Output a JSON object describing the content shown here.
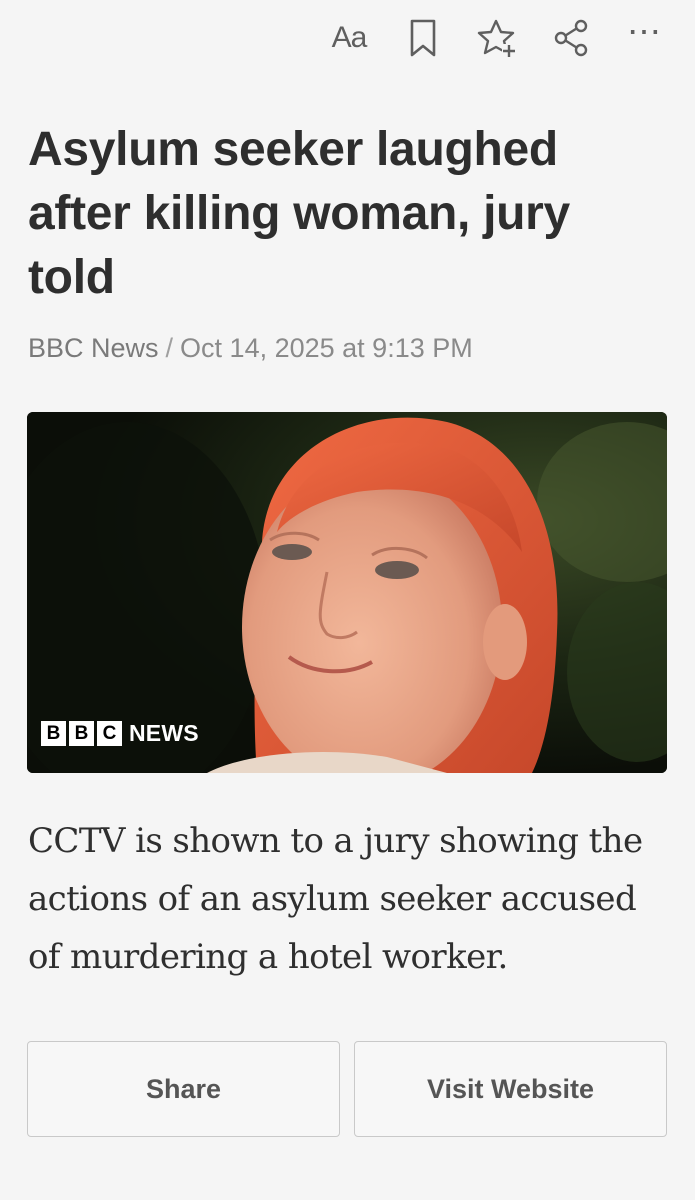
{
  "toolbar": {
    "text_size_label": "Aa",
    "bookmark_icon": "bookmark-icon",
    "favorite_icon": "star-plus-icon",
    "share_icon": "share-icon",
    "more_label": "⋯"
  },
  "article": {
    "headline": "Asylum seeker laughed after killing woman, jury told",
    "source": "BBC News",
    "separator": "/",
    "timestamp": "Oct 14, 2025 at 9:13 PM",
    "image": {
      "description_icon": "portrait-photo",
      "logo_letters": [
        "B",
        "B",
        "C"
      ],
      "logo_text": "NEWS"
    },
    "summary": "CCTV is shown to a jury showing the actions of an asylum seeker accused of murdering a hotel worker."
  },
  "actions": {
    "share_label": "Share",
    "visit_label": "Visit Website"
  },
  "colors": {
    "background": "#f5f5f5",
    "headline": "#2e2e2e",
    "byline": "#8a8a8a",
    "button_border": "#c9c9c9"
  }
}
